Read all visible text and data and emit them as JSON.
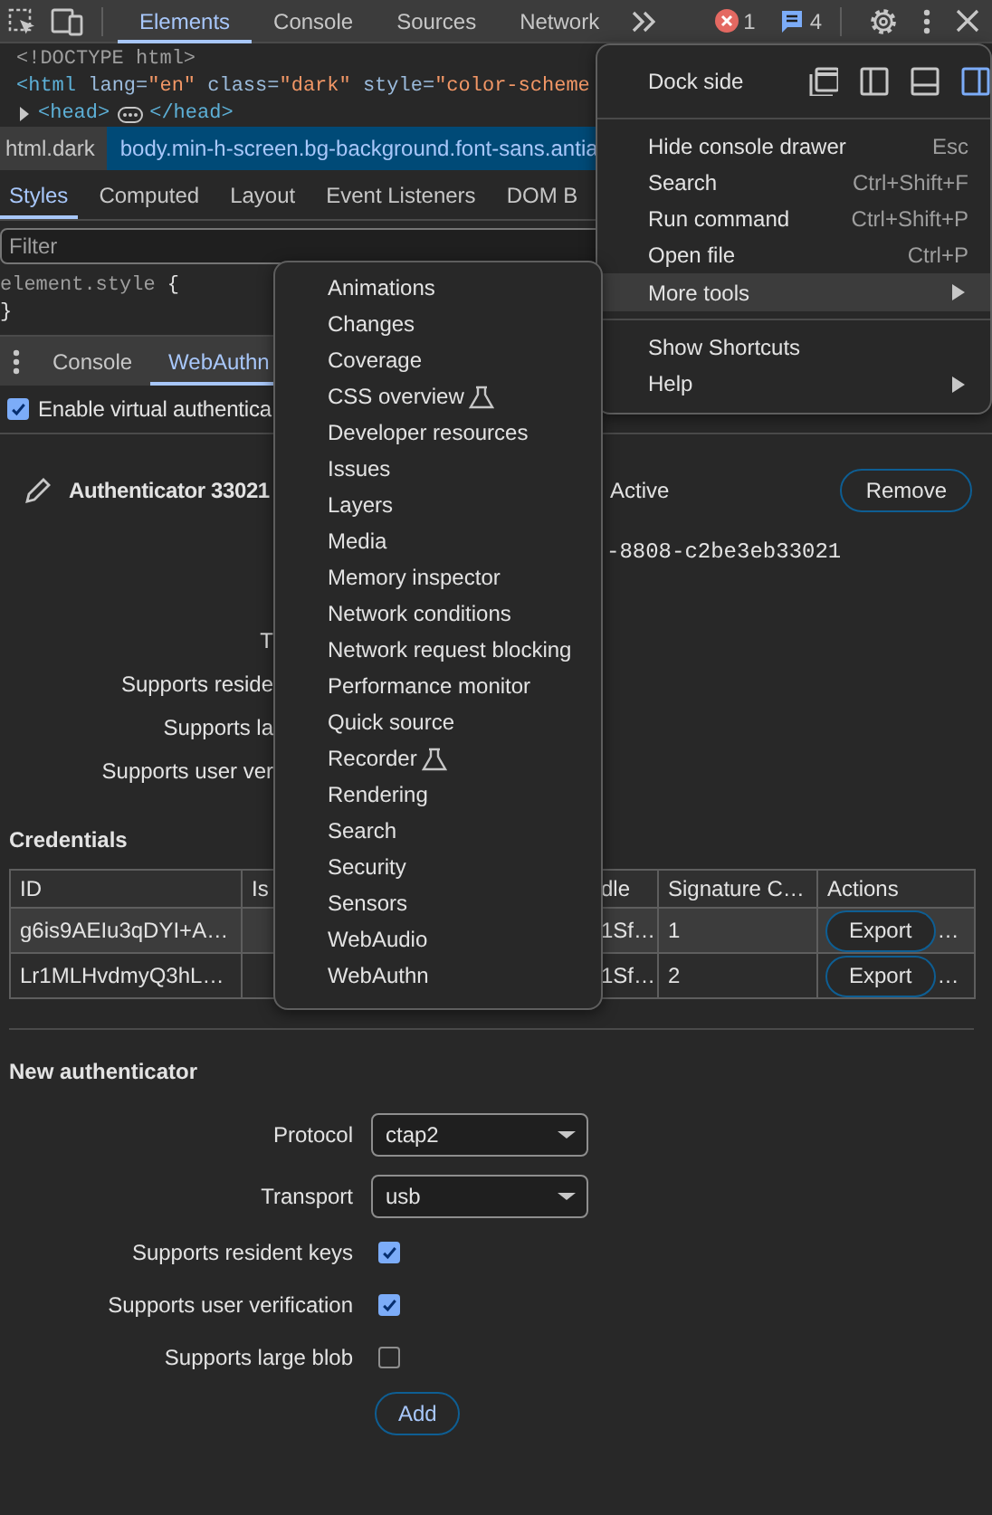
{
  "toolbar": {
    "tabs": [
      {
        "label": "Elements",
        "selected": true
      },
      {
        "label": "Console",
        "selected": false
      },
      {
        "label": "Sources",
        "selected": false
      },
      {
        "label": "Network",
        "selected": false
      }
    ],
    "error_count": "1",
    "message_count": "4"
  },
  "elements_tree": {
    "doctype": "<!DOCTYPE html>",
    "html_line": [
      {
        "kind": "tag",
        "text": "<html"
      },
      {
        "kind": "attr",
        "text": " lang="
      },
      {
        "kind": "value",
        "text": "\"en\""
      },
      {
        "kind": "attr",
        "text": " class="
      },
      {
        "kind": "value",
        "text": "\"dark\""
      },
      {
        "kind": "attr",
        "text": " style="
      },
      {
        "kind": "value",
        "text": "\"color-scheme"
      }
    ],
    "head_line": {
      "open_tag": "<head>",
      "close_tag": "</head>",
      "expanded": false
    }
  },
  "breadcrumbs": [
    {
      "label": "html.dark",
      "selected": false
    },
    {
      "label": "body.min-h-screen.bg-background.font-sans.antia",
      "selected": true
    }
  ],
  "side_tabs": [
    {
      "label": "Styles",
      "selected": true
    },
    {
      "label": "Computed",
      "selected": false
    },
    {
      "label": "Layout",
      "selected": false
    },
    {
      "label": "Event Listeners",
      "selected": false
    },
    {
      "label": "DOM B",
      "selected": false
    }
  ],
  "styles_filter": {
    "placeholder": "Filter"
  },
  "style_rule": {
    "selector": "element.style",
    "open_brace": "{",
    "close_brace": "}"
  },
  "drawer": {
    "tabs": [
      {
        "label": "Console",
        "selected": false
      },
      {
        "label": "WebAuthn",
        "selected": true
      }
    ],
    "enable_virtual": {
      "label": "Enable virtual authentica",
      "checked": true
    }
  },
  "authenticator": {
    "name": "Authenticator 33021",
    "active_label": "Active",
    "remove_button": "Remove",
    "id_value": "-8808-c2be3eb33021",
    "property_labels": [
      "T",
      "Supports reside",
      "Supports la",
      "Supports user ver"
    ]
  },
  "credentials": {
    "title": "Credentials",
    "columns": [
      "ID",
      "Is",
      "dle",
      "Signature C…",
      "Actions"
    ],
    "rows": [
      {
        "selected": true,
        "id": "g6is9AEIu3qDYI+A…",
        "column_3": "1Sf…",
        "signature_count": "1",
        "action": "Export",
        "action_overflow": "…"
      },
      {
        "selected": false,
        "id": "Lr1MLHvdmyQ3hL…",
        "column_3": "1Sf…",
        "signature_count": "2",
        "action": "Export",
        "action_overflow": "…"
      }
    ]
  },
  "new_authenticator": {
    "title": "New authenticator",
    "fields": [
      {
        "kind": "select",
        "label": "Protocol",
        "value": "ctap2"
      },
      {
        "kind": "select",
        "label": "Transport",
        "value": "usb"
      },
      {
        "kind": "checkbox",
        "label": "Supports resident keys",
        "checked": true
      },
      {
        "kind": "checkbox",
        "label": "Supports user verification",
        "checked": true
      },
      {
        "kind": "checkbox",
        "label": "Supports large blob",
        "checked": false
      }
    ],
    "add_button": "Add"
  },
  "main_menu": {
    "dock_side": {
      "label": "Dock side",
      "options": [
        {
          "kind": "undock",
          "selected": false
        },
        {
          "kind": "left",
          "selected": false
        },
        {
          "kind": "bottom",
          "selected": false
        },
        {
          "kind": "right",
          "selected": true
        }
      ]
    },
    "items": [
      {
        "kind": "divider"
      },
      {
        "kind": "item",
        "label": "Hide console drawer",
        "shortcut": "Esc",
        "highlighted": false,
        "has_submenu": false
      },
      {
        "kind": "item",
        "label": "Search",
        "shortcut": "Ctrl+Shift+F",
        "highlighted": false,
        "has_submenu": false
      },
      {
        "kind": "item",
        "label": "Run command",
        "shortcut": "Ctrl+Shift+P",
        "highlighted": false,
        "has_submenu": false
      },
      {
        "kind": "item",
        "label": "Open file",
        "shortcut": "Ctrl+P",
        "highlighted": false,
        "has_submenu": false
      },
      {
        "kind": "item",
        "label": "More tools",
        "highlighted": true,
        "has_submenu": true
      },
      {
        "kind": "divider"
      },
      {
        "kind": "item",
        "label": "Show Shortcuts",
        "highlighted": false,
        "has_submenu": false
      },
      {
        "kind": "item",
        "label": "Help",
        "highlighted": false,
        "has_submenu": true
      }
    ]
  },
  "more_tools_menu": {
    "items": [
      {
        "label": "Animations",
        "experimental": false
      },
      {
        "label": "Changes",
        "experimental": false
      },
      {
        "label": "Coverage",
        "experimental": false
      },
      {
        "label": "CSS overview",
        "experimental": true
      },
      {
        "label": "Developer resources",
        "experimental": false
      },
      {
        "label": "Issues",
        "experimental": false
      },
      {
        "label": "Layers",
        "experimental": false
      },
      {
        "label": "Media",
        "experimental": false
      },
      {
        "label": "Memory inspector",
        "experimental": false
      },
      {
        "label": "Network conditions",
        "experimental": false
      },
      {
        "label": "Network request blocking",
        "experimental": false
      },
      {
        "label": "Performance monitor",
        "experimental": false
      },
      {
        "label": "Quick source",
        "experimental": false
      },
      {
        "label": "Recorder",
        "experimental": true
      },
      {
        "label": "Rendering",
        "experimental": false
      },
      {
        "label": "Search",
        "experimental": false
      },
      {
        "label": "Security",
        "experimental": false
      },
      {
        "label": "Sensors",
        "experimental": false
      },
      {
        "label": "WebAudio",
        "experimental": false
      },
      {
        "label": "WebAuthn",
        "experimental": false
      }
    ]
  }
}
